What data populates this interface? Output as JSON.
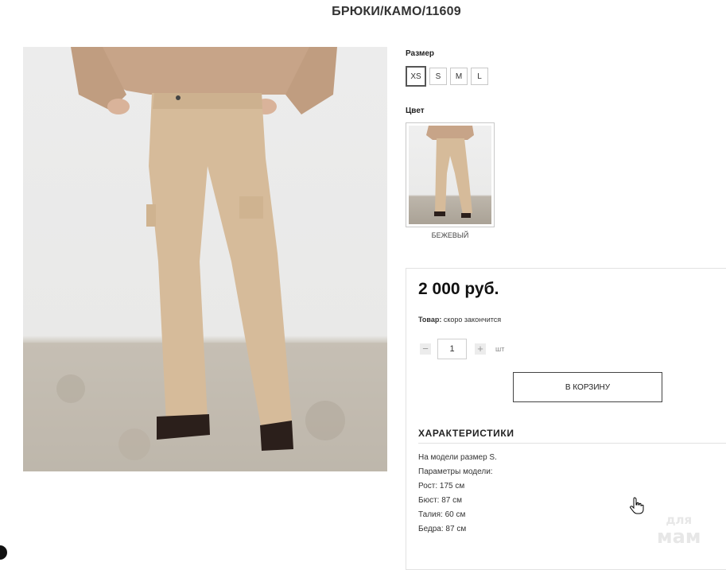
{
  "product": {
    "title": "БРЮКИ/КАМО/11609"
  },
  "options": {
    "size_label": "Размер",
    "sizes": [
      "XS",
      "S",
      "M",
      "L"
    ],
    "selected_size": "XS",
    "color_label": "Цвет",
    "color_name": "БЕЖЕВЫЙ"
  },
  "purchase": {
    "price": "2 000 руб.",
    "stock_label": "Товар:",
    "stock_value": "скоро закончится",
    "quantity": "1",
    "minus": "−",
    "plus": "+",
    "unit": "шт",
    "cart_button": "В КОРЗИНУ"
  },
  "specs": {
    "title": "ХАРАКТЕРИСТИКИ",
    "lines": [
      "На модели размер S.",
      "Параметры модели:",
      "Рост: 175 см",
      "Бюст: 87 см",
      "Талия: 60 см",
      "Бедра: 87 см"
    ]
  },
  "watermark": {
    "line1": "для",
    "line2": "мам"
  },
  "colors": {
    "pants": "#d6bb9a",
    "sweater": "#c7a488",
    "shoes": "#2b1f1b",
    "border": "#c8c8c8"
  }
}
